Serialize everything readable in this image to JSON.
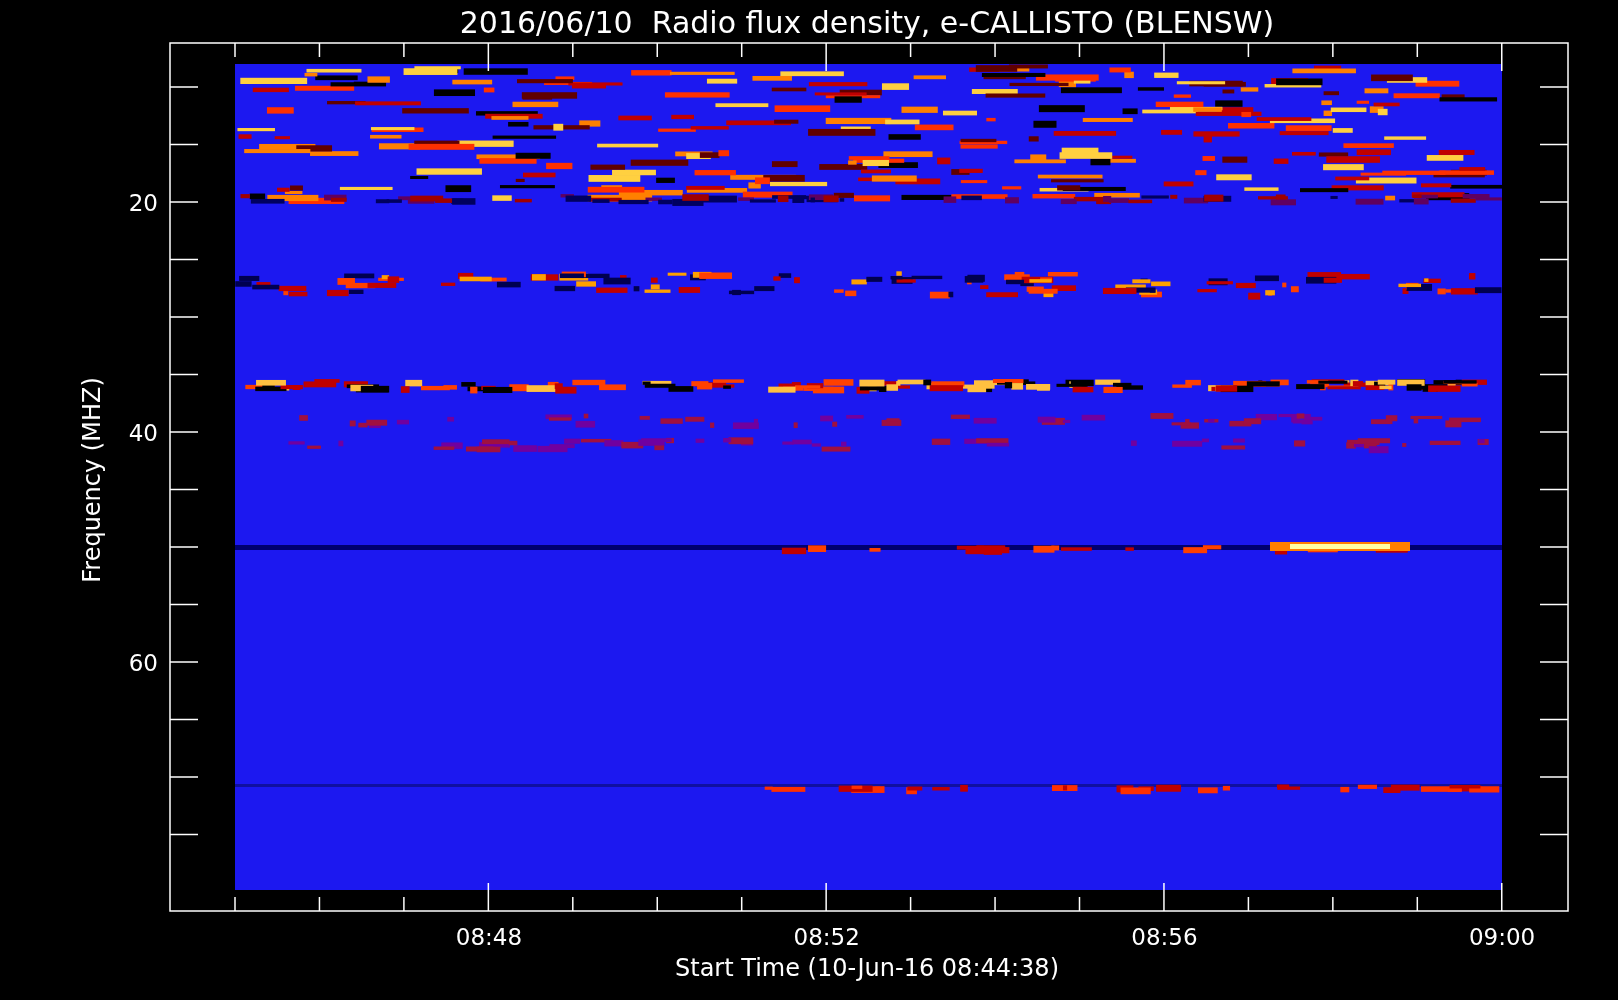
{
  "title": "2016/06/10  Radio flux density, e-CALLISTO (BLENSW)",
  "y_axis": {
    "label": "Frequency (MHZ)",
    "tick_labels": [
      "20",
      "40",
      "60"
    ]
  },
  "x_axis": {
    "label": "Start Time (10-Jun-16 08:44:38)",
    "tick_labels": [
      "08:48",
      "08:52",
      "08:56",
      "09:00"
    ]
  }
}
